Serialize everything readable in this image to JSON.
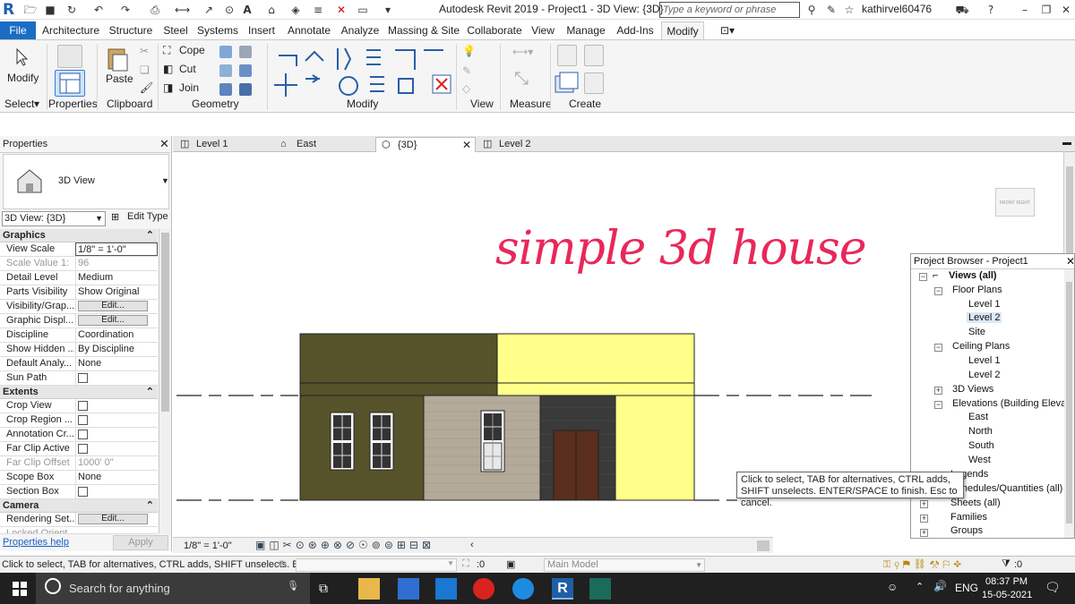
{
  "app": {
    "window_title": "Autodesk Revit 2019 - Project1 - 3D View: {3D}",
    "search_placeholder": "Type a keyword or phrase",
    "username": "kathirvel60476"
  },
  "menu_tabs": [
    "File",
    "Architecture",
    "Structure",
    "Steel",
    "Systems",
    "Insert",
    "Annotate",
    "Analyze",
    "Massing & Site",
    "Collaborate",
    "View",
    "Manage",
    "Add-Ins",
    "Modify"
  ],
  "ribbon": {
    "panels": [
      "Select",
      "Properties",
      "Clipboard",
      "Geometry",
      "Modify",
      "View",
      "Measure",
      "Create"
    ],
    "modify_label": "Modify",
    "paste_label": "Paste",
    "cope_label": "Cope",
    "cut_label": "Cut",
    "join_label": "Join"
  },
  "properties": {
    "title": "Properties",
    "type_name": "3D View",
    "instance_selector": "3D View: {3D}",
    "edit_type": "Edit Type",
    "sections": {
      "graphics": "Graphics",
      "extents": "Extents",
      "camera": "Camera"
    },
    "graphics_rows": [
      {
        "k": "View Scale",
        "v": "1/8\" = 1'-0\""
      },
      {
        "k": "Scale Value    1:",
        "v": "96"
      },
      {
        "k": "Detail Level",
        "v": "Medium"
      },
      {
        "k": "Parts Visibility",
        "v": "Show Original"
      },
      {
        "k": "Visibility/Grap...",
        "v": "Edit..."
      },
      {
        "k": "Graphic Displ...",
        "v": "Edit..."
      },
      {
        "k": "Discipline",
        "v": "Coordination"
      },
      {
        "k": "Show Hidden ...",
        "v": "By Discipline"
      },
      {
        "k": "Default Analy...",
        "v": "None"
      },
      {
        "k": "Sun Path",
        "v": ""
      }
    ],
    "extents_rows": [
      {
        "k": "Crop View",
        "v": ""
      },
      {
        "k": "Crop Region ...",
        "v": ""
      },
      {
        "k": "Annotation Cr...",
        "v": ""
      },
      {
        "k": "Far Clip Active",
        "v": ""
      },
      {
        "k": "Far Clip Offset",
        "v": "1000'  0\""
      },
      {
        "k": "Scope Box",
        "v": "None"
      },
      {
        "k": "Section Box",
        "v": ""
      }
    ],
    "camera_rows": [
      {
        "k": "Rendering Set...",
        "v": "Edit..."
      },
      {
        "k": "Locked Orient...",
        "v": ""
      }
    ],
    "help_link": "Properties help",
    "apply": "Apply"
  },
  "view_tabs": [
    "Level 1",
    "East",
    "{3D}",
    "Level 2"
  ],
  "canvas": {
    "heading": "simple 3d house",
    "viewcube_front": "FRONT",
    "viewcube_right": "RIGHT"
  },
  "view_control": {
    "scale": "1/8\" = 1'-0\""
  },
  "project_browser": {
    "title": "Project Browser - Project1",
    "views_all": "Views (all)",
    "floor_plans": "Floor Plans",
    "fp_items": [
      "Level 1",
      "Level 2",
      "Site"
    ],
    "ceiling_plans": "Ceiling Plans",
    "cp_items": [
      "Level 1",
      "Level 2"
    ],
    "views_3d": "3D Views",
    "elevations": "Elevations (Building Elevati",
    "el_items": [
      "East",
      "North",
      "South",
      "West"
    ],
    "legends": "Legends",
    "schedules": "Schedules/Quantities (all)",
    "sheets": "Sheets (all)",
    "families": "Families",
    "groups": "Groups"
  },
  "tooltip": "Click to select, TAB for alternatives, CTRL adds, SHIFT unselects. ENTER/SPACE to finish. Esc to cancel.",
  "status_bar": {
    "text": "Click to select, TAB for alternatives, CTRL adds, SHIFT unselects. E",
    "workset_value": ":0",
    "model": "Main Model",
    "filter_count": ":0"
  },
  "taskbar": {
    "search": "Search for anything",
    "lang": "ENG",
    "time": "08:37 PM",
    "date": "15-05-2021"
  },
  "colors": {
    "file_tab": "#1b6cc4",
    "house_dark": "#56522a",
    "house_yellow": "#ffff8a",
    "heading": "#e8285a",
    "door": "#5a2e1c",
    "taskbar": "#202020"
  }
}
